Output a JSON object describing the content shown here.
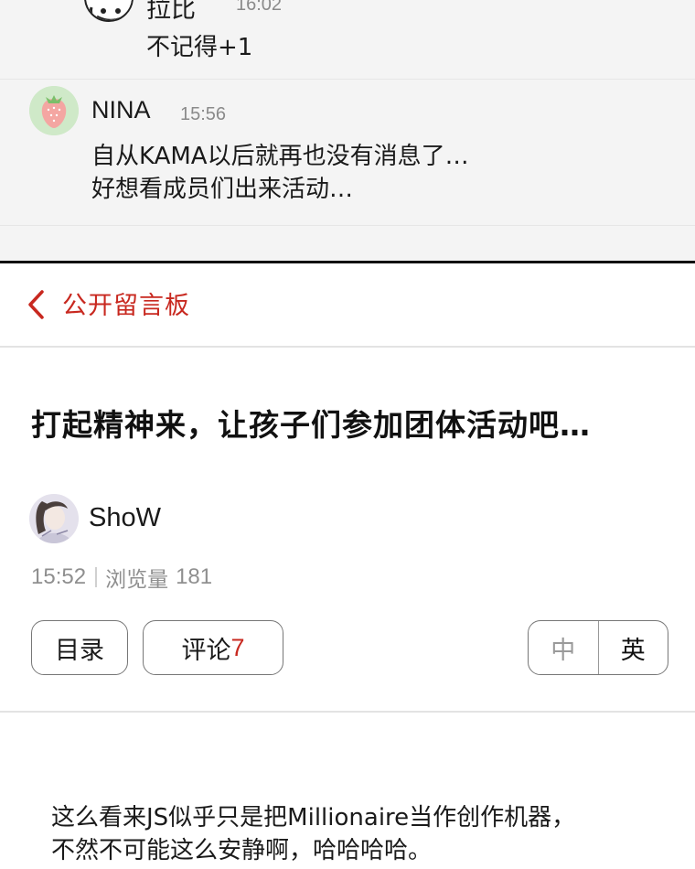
{
  "comments": [
    {
      "name": "拉比",
      "time": "16:02",
      "text": "不记得+1",
      "avatar_icon": "cartoon-face-avatar"
    },
    {
      "name": "NINA",
      "time": "15:56",
      "text_lines": [
        "自从KAMA以后就再也没有消息了…",
        "好想看成员们出来活动…"
      ],
      "avatar_icon": "strawberry-avatar"
    }
  ],
  "board": {
    "back_icon": "chevron-left-icon",
    "title": "公开留言板"
  },
  "post": {
    "title": "打起精神来，让孩子们参加团体活动吧…",
    "author": "ShoW",
    "time": "15:52",
    "views_label": "浏览量",
    "views": "181",
    "body_lines": [
      "这么看来JS似乎只是把Millionaire当作创作机器，",
      "不然不可能这么安静啊，哈哈哈哈。"
    ]
  },
  "buttons": {
    "toc": "目录",
    "comments_label": "评论",
    "comments_count": "7"
  },
  "language": {
    "zh": "中",
    "en": "英",
    "selected": "en"
  },
  "colors": {
    "accent": "#c8281f",
    "panel_bg": "#f4f4f4"
  }
}
